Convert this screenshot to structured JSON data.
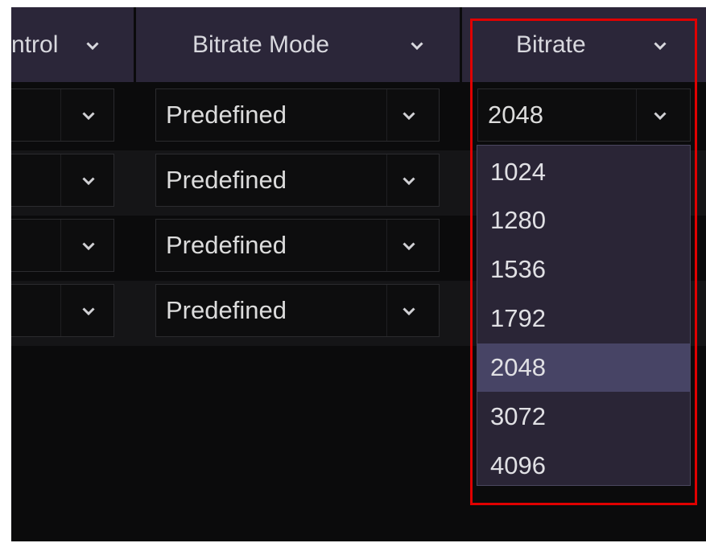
{
  "header": {
    "columns": [
      {
        "label": "ntrol"
      },
      {
        "label": "Bitrate Mode"
      },
      {
        "label": "Bitrate"
      }
    ]
  },
  "rows": [
    {
      "mode": "Predefined",
      "bitrate": "2048"
    },
    {
      "mode": "Predefined"
    },
    {
      "mode": "Predefined"
    },
    {
      "mode": "Predefined"
    }
  ],
  "bitrate_dropdown": {
    "options": [
      "1024",
      "1280",
      "1536",
      "1792",
      "2048",
      "3072",
      "4096"
    ],
    "selected": "2048"
  },
  "colors": {
    "header_bg": "#2b2639",
    "dropdown_bg": "#2a2536",
    "selected_option_bg": "#474465",
    "highlight_border": "#e00000"
  }
}
